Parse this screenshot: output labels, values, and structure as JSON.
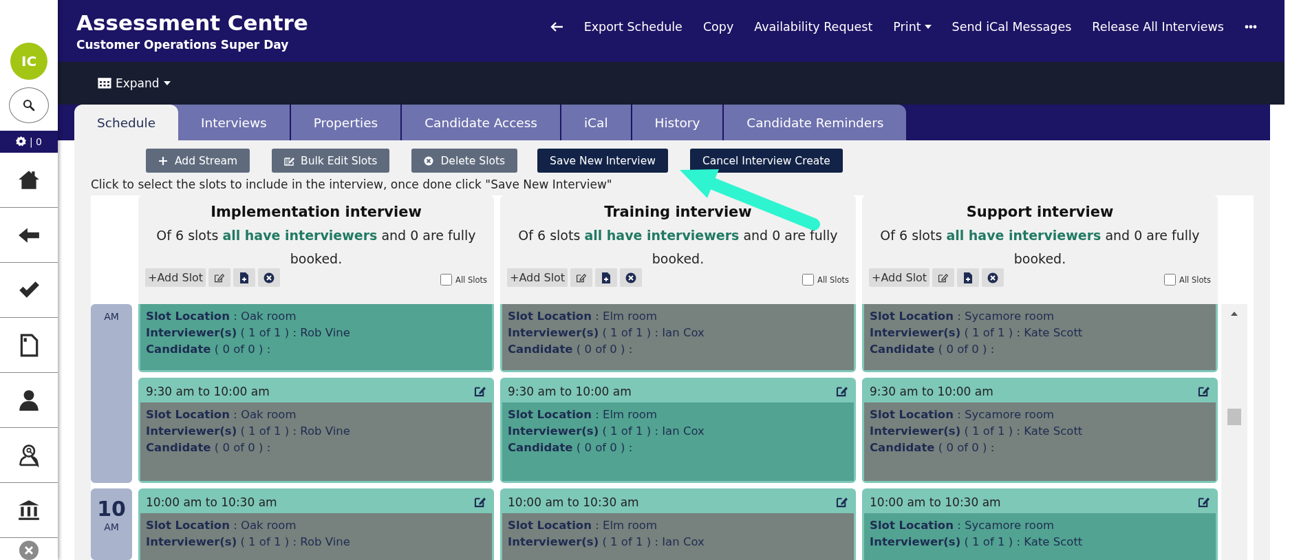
{
  "sidebar": {
    "avatar": "IC",
    "counter": "| 0"
  },
  "header": {
    "title": "Assessment Centre",
    "subtitle": "Customer Operations Super Day",
    "actions": [
      {
        "kind": "back"
      },
      {
        "kind": "link",
        "label": "Export Schedule",
        "dropdown": false
      },
      {
        "kind": "link",
        "label": "Copy",
        "dropdown": false
      },
      {
        "kind": "link",
        "label": "Availability Request",
        "dropdown": false
      },
      {
        "kind": "link",
        "label": "Print",
        "dropdown": true
      },
      {
        "kind": "link",
        "label": "Send iCal Messages",
        "dropdown": false
      },
      {
        "kind": "link",
        "label": "Release All Interviews",
        "dropdown": false
      },
      {
        "kind": "more"
      }
    ]
  },
  "toolbar": {
    "label": "Expand",
    "dropdown": true
  },
  "tabs": [
    {
      "label": "Schedule",
      "selected": true
    },
    {
      "label": "Interviews",
      "selected": false
    },
    {
      "label": "Properties",
      "selected": false
    },
    {
      "label": "Candidate Access",
      "selected": false
    },
    {
      "label": "iCal",
      "selected": false
    },
    {
      "label": "History",
      "selected": false
    },
    {
      "label": "Candidate Reminders",
      "selected": false
    }
  ],
  "buttons": [
    {
      "kind": "add",
      "label": "Add Stream"
    },
    {
      "kind": "edit",
      "label": "Bulk Edit Slots"
    },
    {
      "kind": "delete",
      "label": "Delete Slots"
    },
    {
      "kind": "primary",
      "label": "Save New Interview"
    },
    {
      "kind": "primary",
      "label": "Cancel Interview Create"
    }
  ],
  "instruction": "Click to select the slots to include in the interview, once done click \"Save New Interview\"",
  "time_blocks": [
    {
      "period": "AM"
    },
    {
      "hour": "10",
      "period": "AM"
    }
  ],
  "streams": [
    {
      "title": "Implementation interview",
      "summary": "Of 6 slots **all have interviewers** and 0 are fully booked.",
      "add_slot": "+Add Slot",
      "all_slots_label": "All Slots",
      "all_slots_checked": false,
      "slots": [
        {
          "selected": true,
          "location": "**Slot Location** : Oak room",
          "interviewers": "**Interviewer(s)** ( 1 of 1 ) : Rob Vine",
          "candidate": "**Candidate** ( 0 of 0 ) :"
        },
        {
          "selected": false,
          "time": "9:30 am to 10:00 am",
          "location": "**Slot Location** : Oak room",
          "interviewers": "**Interviewer(s)** ( 1 of 1 ) : Rob Vine",
          "candidate": "**Candidate** ( 0 of 0 ) :"
        },
        {
          "selected": false,
          "time": "10:00 am to 10:30 am",
          "location": "**Slot Location** : Oak room",
          "interviewers": "**Interviewer(s)** ( 1 of 1 ) : Rob Vine"
        }
      ]
    },
    {
      "title": "Training interview",
      "summary": "Of 6 slots **all have interviewers** and 0 are fully booked.",
      "add_slot": "+Add Slot",
      "all_slots_label": "All Slots",
      "all_slots_checked": false,
      "slots": [
        {
          "selected": false,
          "location": "**Slot Location** : Elm room",
          "interviewers": "**Interviewer(s)** ( 1 of 1 ) : Ian Cox",
          "candidate": "**Candidate** ( 0 of 0 ) :"
        },
        {
          "selected": true,
          "time": "9:30 am to 10:00 am",
          "location": "**Slot Location** : Elm room",
          "interviewers": "**Interviewer(s)** ( 1 of 1 ) : Ian Cox",
          "candidate": "**Candidate** ( 0 of 0 ) :"
        },
        {
          "selected": false,
          "time": "10:00 am to 10:30 am",
          "location": "**Slot Location** : Elm room",
          "interviewers": "**Interviewer(s)** ( 1 of 1 ) : Ian Cox"
        }
      ]
    },
    {
      "title": "Support interview",
      "summary": "Of 6 slots **all have interviewers** and 0 are fully booked.",
      "add_slot": "+Add Slot",
      "all_slots_label": "All Slots",
      "all_slots_checked": false,
      "slots": [
        {
          "selected": false,
          "location": "**Slot Location** : Sycamore room",
          "interviewers": "**Interviewer(s)** ( 1 of 1 ) : Kate Scott",
          "candidate": "**Candidate** ( 0 of 0 ) :"
        },
        {
          "selected": false,
          "time": "9:30 am to 10:00 am",
          "location": "**Slot Location** : Sycamore room",
          "interviewers": "**Interviewer(s)** ( 1 of 1 ) : Kate Scott",
          "candidate": "**Candidate** ( 0 of 0 ) :"
        },
        {
          "selected": true,
          "time": "10:00 am to 10:30 am",
          "location": "**Slot Location** : Sycamore room",
          "interviewers": "**Interviewer(s)** ( 1 of 1 ) : Kate Scott"
        }
      ]
    }
  ]
}
